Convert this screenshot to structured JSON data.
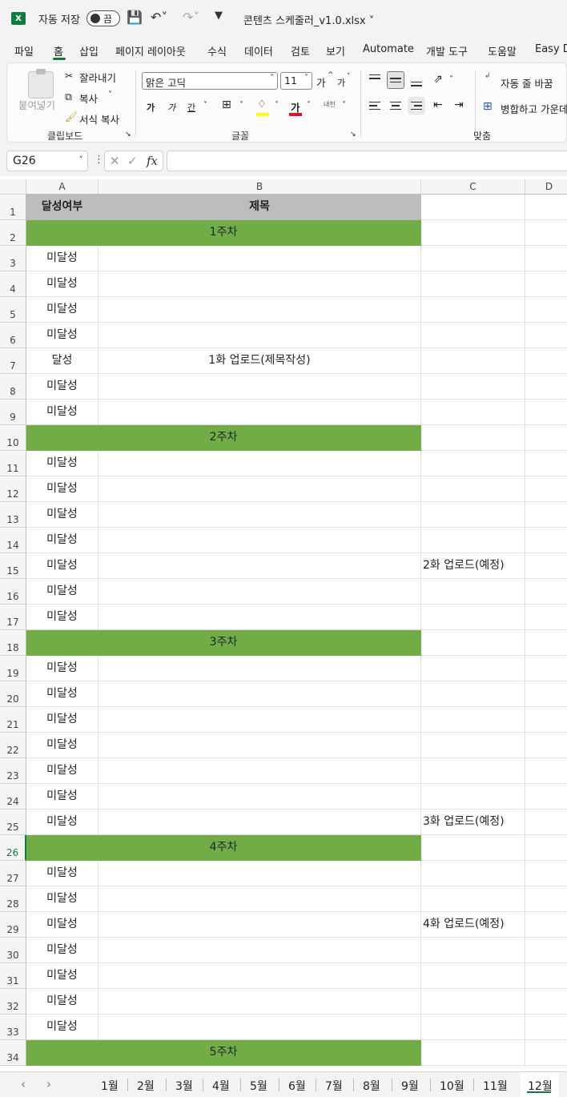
{
  "titlebar": {
    "autosave_label": "자동 저장",
    "autosave_state": "끔",
    "filename": "콘텐츠 스케줄러_v1.0.xlsx"
  },
  "ribbon_tabs": [
    "파일",
    "홈",
    "삽입",
    "페이지 레이아웃",
    "수식",
    "데이터",
    "검토",
    "보기",
    "Automate",
    "개발 도구",
    "도움말",
    "Easy D"
  ],
  "active_tab": "홈",
  "clipboard": {
    "paste": "붙여넣기",
    "cut": "잘라내기",
    "copy": "복사",
    "format_painter": "서식 복사",
    "group_label": "클립보드"
  },
  "font": {
    "font_name": "맑은 고딕",
    "font_size": "11",
    "grow": "가",
    "shrink": "가",
    "bold": "가",
    "italic": "가",
    "underline": "간",
    "font_color_glyph": "가",
    "phonetic": "내천",
    "group_label": "글꼴"
  },
  "alignment": {
    "wrap_text": "자동 줄 바꿈",
    "merge_center": "병합하고 가운데",
    "group_label": "맞춤"
  },
  "formula_bar": {
    "name_box": "G26",
    "fx": "fx",
    "formula": ""
  },
  "sheet": {
    "columns": [
      "A",
      "B",
      "C",
      "D"
    ],
    "rows": [
      {
        "n": "1",
        "a": "달성여부",
        "b": "제목",
        "c": "",
        "type": "header"
      },
      {
        "n": "2",
        "a": "",
        "b": "1주차",
        "c": "",
        "type": "week"
      },
      {
        "n": "3",
        "a": "미달성",
        "b": "",
        "c": "",
        "type": "data"
      },
      {
        "n": "4",
        "a": "미달성",
        "b": "",
        "c": "",
        "type": "data"
      },
      {
        "n": "5",
        "a": "미달성",
        "b": "",
        "c": "",
        "type": "data"
      },
      {
        "n": "6",
        "a": "미달성",
        "b": "",
        "c": "",
        "type": "data"
      },
      {
        "n": "7",
        "a": "달성",
        "b": "1화 업로드(제목작성)",
        "c": "",
        "type": "data"
      },
      {
        "n": "8",
        "a": "미달성",
        "b": "",
        "c": "",
        "type": "data"
      },
      {
        "n": "9",
        "a": "미달성",
        "b": "",
        "c": "",
        "type": "data"
      },
      {
        "n": "10",
        "a": "",
        "b": "2주차",
        "c": "",
        "type": "week"
      },
      {
        "n": "11",
        "a": "미달성",
        "b": "",
        "c": "",
        "type": "data"
      },
      {
        "n": "12",
        "a": "미달성",
        "b": "",
        "c": "",
        "type": "data"
      },
      {
        "n": "13",
        "a": "미달성",
        "b": "",
        "c": "",
        "type": "data"
      },
      {
        "n": "14",
        "a": "미달성",
        "b": "",
        "c": "",
        "type": "data"
      },
      {
        "n": "15",
        "a": "미달성",
        "b": "",
        "c": "2화 업로드(예정)",
        "type": "data"
      },
      {
        "n": "16",
        "a": "미달성",
        "b": "",
        "c": "",
        "type": "data"
      },
      {
        "n": "17",
        "a": "미달성",
        "b": "",
        "c": "",
        "type": "data"
      },
      {
        "n": "18",
        "a": "",
        "b": "3주차",
        "c": "",
        "type": "week"
      },
      {
        "n": "19",
        "a": "미달성",
        "b": "",
        "c": "",
        "type": "data"
      },
      {
        "n": "20",
        "a": "미달성",
        "b": "",
        "c": "",
        "type": "data"
      },
      {
        "n": "21",
        "a": "미달성",
        "b": "",
        "c": "",
        "type": "data"
      },
      {
        "n": "22",
        "a": "미달성",
        "b": "",
        "c": "",
        "type": "data"
      },
      {
        "n": "23",
        "a": "미달성",
        "b": "",
        "c": "",
        "type": "data"
      },
      {
        "n": "24",
        "a": "미달성",
        "b": "",
        "c": "",
        "type": "data"
      },
      {
        "n": "25",
        "a": "미달성",
        "b": "",
        "c": "3화 업로드(예정)",
        "type": "data"
      },
      {
        "n": "26",
        "a": "",
        "b": "4주차",
        "c": "",
        "type": "week"
      },
      {
        "n": "27",
        "a": "미달성",
        "b": "",
        "c": "",
        "type": "data"
      },
      {
        "n": "28",
        "a": "미달성",
        "b": "",
        "c": "",
        "type": "data"
      },
      {
        "n": "29",
        "a": "미달성",
        "b": "",
        "c": "4화 업로드(예정)",
        "type": "data"
      },
      {
        "n": "30",
        "a": "미달성",
        "b": "",
        "c": "",
        "type": "data"
      },
      {
        "n": "31",
        "a": "미달성",
        "b": "",
        "c": "",
        "type": "data"
      },
      {
        "n": "32",
        "a": "미달성",
        "b": "",
        "c": "",
        "type": "data"
      },
      {
        "n": "33",
        "a": "미달성",
        "b": "",
        "c": "",
        "type": "data"
      },
      {
        "n": "34",
        "a": "",
        "b": "5주차",
        "c": "",
        "type": "week"
      }
    ],
    "active_row": "26"
  },
  "sheet_tabs": [
    "1월",
    "2월",
    "3월",
    "4월",
    "5월",
    "6월",
    "7월",
    "8월",
    "9월",
    "10월",
    "11월",
    "12월"
  ],
  "active_sheet": "12월",
  "colors": {
    "week_fill": "#70ad47",
    "header_fill": "#bdbdbd",
    "accent": "#107c41"
  }
}
